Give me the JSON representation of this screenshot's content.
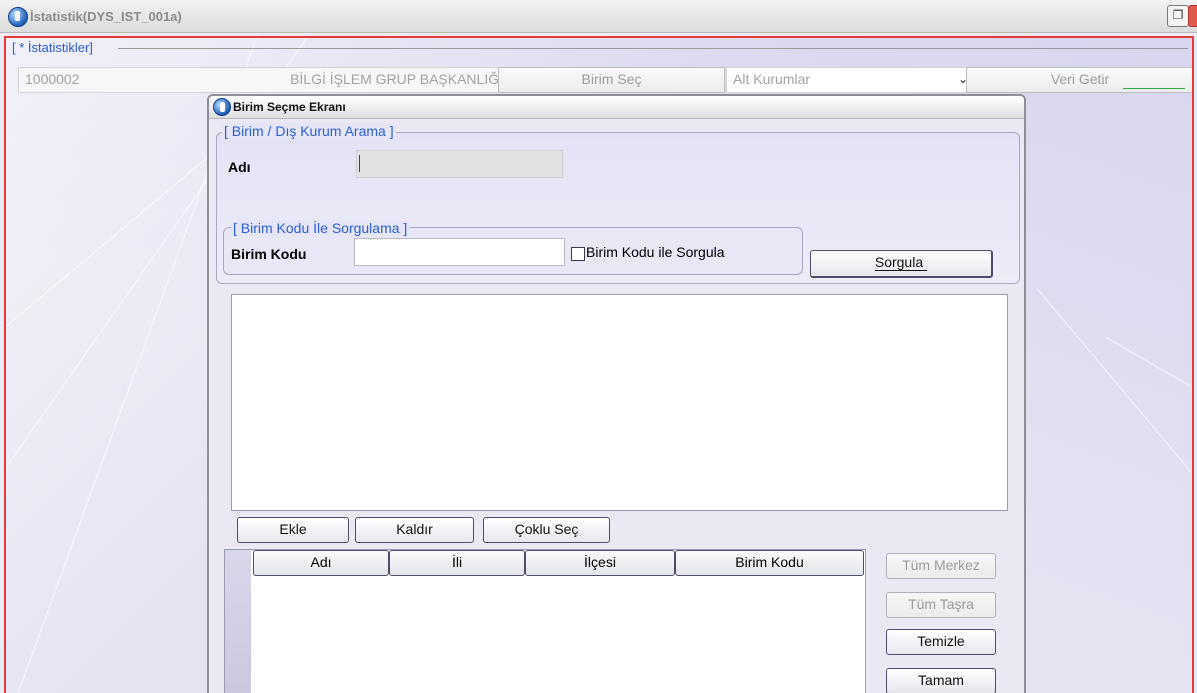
{
  "window": {
    "title": "İstatistik(DYS_IST_001a)"
  },
  "filter_group": {
    "legend": "[ * İstatistikler]",
    "unit_code": "1000002",
    "unit_name": "BİLGİ İŞLEM GRUP BAŞKANLIĞI",
    "select_unit_button": "Birim Seç",
    "sub_institution_select": "Alt Kurumlar",
    "fetch_button": "Veri Getir"
  },
  "dialog": {
    "title": "Birim Seçme Ekranı",
    "search_group": {
      "legend": "[ Birim / Dış Kurum Arama ]",
      "name_label": "Adı",
      "name_value": "",
      "code_group": {
        "legend": "[ Birim Kodu İle Sorgulama ]",
        "code_label": "Birim Kodu",
        "code_value": "",
        "checkbox_label": "Birim Kodu ile Sorgula",
        "checkbox_checked": false
      },
      "query_button": "Sorgula"
    },
    "actions": {
      "add": "Ekle",
      "remove": "Kaldır",
      "multi_select": "Çoklu Seç"
    },
    "table": {
      "columns": [
        "Adı",
        "İli",
        "İlçesi",
        "Birim Kodu"
      ],
      "rows": []
    },
    "side_buttons": {
      "all_center": "Tüm Merkez",
      "all_province": "Tüm Taşra",
      "clear": "Temizle",
      "ok": "Tamam"
    }
  },
  "colors": {
    "accent_blue": "#2a5dd1",
    "frame_red": "#e23b3b"
  }
}
